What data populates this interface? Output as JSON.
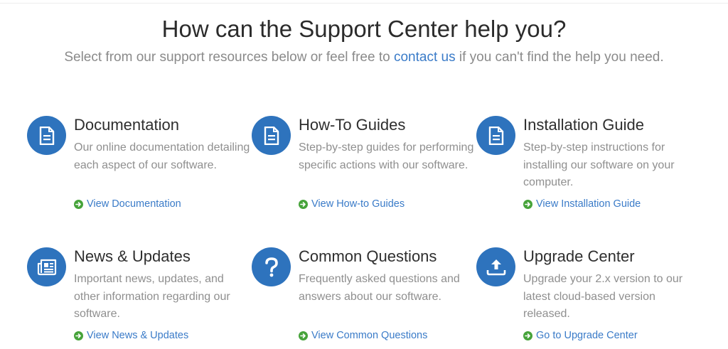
{
  "hero": {
    "title": "How can the Support Center help you?",
    "subtitle_before": "Select from our support resources below or feel free to",
    "contact_link": "contact us",
    "subtitle_after": "if you can't find the help you need."
  },
  "colors": {
    "icon_bg": "#2e73bd",
    "link": "#3a7bc8",
    "arrow": "#46a33a"
  },
  "cards": [
    {
      "title": "Documentation",
      "desc": "Our online documentation detailing each aspect of our software.",
      "link": "View Documentation",
      "icon": "document-icon"
    },
    {
      "title": "How-To Guides",
      "desc": "Step-by-step guides for performing specific actions with our software.",
      "link": "View How-to Guides",
      "icon": "document-icon"
    },
    {
      "title": "Installation Guide",
      "desc": "Step-by-step instructions for installing our software on your computer.",
      "link": "View Installation Guide",
      "icon": "document-icon"
    },
    {
      "title": "News & Updates",
      "desc": "Important news, updates, and other information regarding our software.",
      "link": "View News & Updates",
      "icon": "newspaper-icon"
    },
    {
      "title": "Common Questions",
      "desc": "Frequently asked questions and answers about our software.",
      "link": "View Common Questions",
      "icon": "question-icon"
    },
    {
      "title": "Upgrade Center",
      "desc": "Upgrade your 2.x version to our latest cloud-based version released.",
      "link": "Go to Upgrade Center",
      "icon": "upload-icon"
    }
  ]
}
